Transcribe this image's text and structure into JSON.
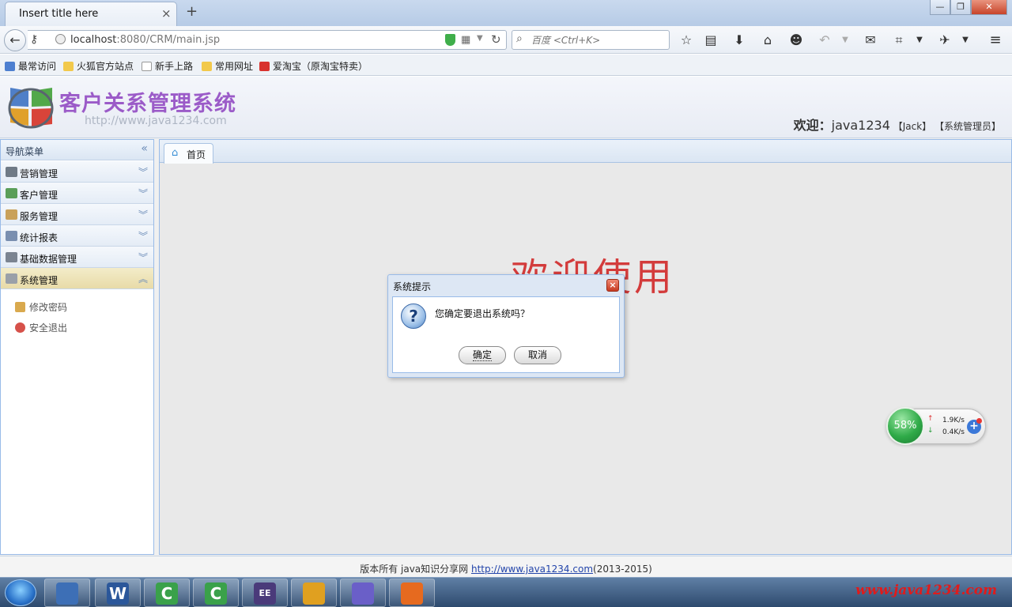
{
  "browser": {
    "tab_title": "Insert title here",
    "tab_close": "×",
    "new_tab": "+",
    "url_prefix": "localhost",
    "url_rest": ":8080/CRM/main.jsp",
    "search_placeholder": "百度 <Ctrl+K>"
  },
  "bookmarks": [
    {
      "label": "最常访问",
      "color": "#4d7fd0"
    },
    {
      "label": "火狐官方站点",
      "color": "#f2c94c"
    },
    {
      "label": "新手上路",
      "color": "#ffffff"
    },
    {
      "label": "常用网址",
      "color": "#f2c94c"
    },
    {
      "label": "爱淘宝（原淘宝特卖）",
      "color": "#d8322e"
    }
  ],
  "app": {
    "title": "客户关系管理系统",
    "site_url": "http://www.java1234.com",
    "welcome_label": "欢迎：",
    "welcome_user": "java1234",
    "welcome_name": "【Jack】",
    "welcome_role": "【系统管理员】"
  },
  "nav": {
    "title": "导航菜单",
    "collapse_icon": "«",
    "panels": [
      {
        "label": "营销管理",
        "icon_color": "#6f7a86",
        "chevron": "︾"
      },
      {
        "label": "客户管理",
        "icon_color": "#5a9e58",
        "chevron": "︾"
      },
      {
        "label": "服务管理",
        "icon_color": "#c9a15a",
        "chevron": "︾"
      },
      {
        "label": "统计报表",
        "icon_color": "#7a8fb0",
        "chevron": "︾"
      },
      {
        "label": "基础数据管理",
        "icon_color": "#7b8491",
        "chevron": "︾"
      },
      {
        "label": "系统管理",
        "icon_color": "#9aa0a8",
        "chevron": "︽"
      }
    ],
    "sub_items": [
      {
        "label": "修改密码",
        "icon_color": "#d9a94e"
      },
      {
        "label": "安全退出",
        "icon_color": "#d6514a"
      }
    ]
  },
  "content": {
    "tab_home": "首页",
    "welcome_big": "欢迎使用"
  },
  "dialog": {
    "title": "系统提示",
    "close": "×",
    "message": "您确定要退出系统吗？",
    "ok": "确定",
    "cancel": "取消"
  },
  "footer": {
    "prefix": "版本所有 java知识分享网 ",
    "link": "http://www.java1234.com",
    "suffix": "(2013-2015)"
  },
  "net_widget": {
    "percent": "58%",
    "up": "1.9K/s",
    "down": "0.4K/s"
  },
  "taskbar": {
    "watermark": "www.java1234.com",
    "apps": [
      {
        "name": "Winamp",
        "glyph": "",
        "color": "#3d6fb6"
      },
      {
        "name": "Word",
        "glyph": "W",
        "color": "#2b579a"
      },
      {
        "name": "Camtasia",
        "glyph": "C",
        "color": "#3aa14a"
      },
      {
        "name": "Camtasia Studio",
        "glyph": "C",
        "color": "#3aa14a"
      },
      {
        "name": "Java EE IDE",
        "glyph": "EE",
        "color": "#4a3a7a"
      },
      {
        "name": "Chrome",
        "glyph": "",
        "color": "#e0a020"
      },
      {
        "name": "Snipping",
        "glyph": "",
        "color": "#6a5fc8"
      },
      {
        "name": "Firefox",
        "glyph": "",
        "color": "#e66a1f"
      }
    ]
  }
}
